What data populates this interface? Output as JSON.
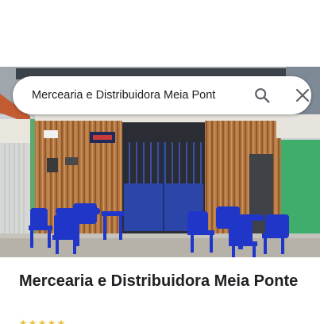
{
  "search": {
    "query": "Mercearia e Distribuidora Meia Pont"
  },
  "place": {
    "title": "Mercearia e Distribuidora Meia Ponte"
  },
  "icons": {
    "search": "search-icon",
    "close": "close-icon",
    "rating": "star-icon"
  },
  "colors": {
    "text_primary": "#202124",
    "icon_gray": "#5f6368",
    "furniture_blue": "#1f36c9",
    "gate_blue": "#2b46a8",
    "log_wall": "#b57843",
    "star": "#e8c33b"
  }
}
